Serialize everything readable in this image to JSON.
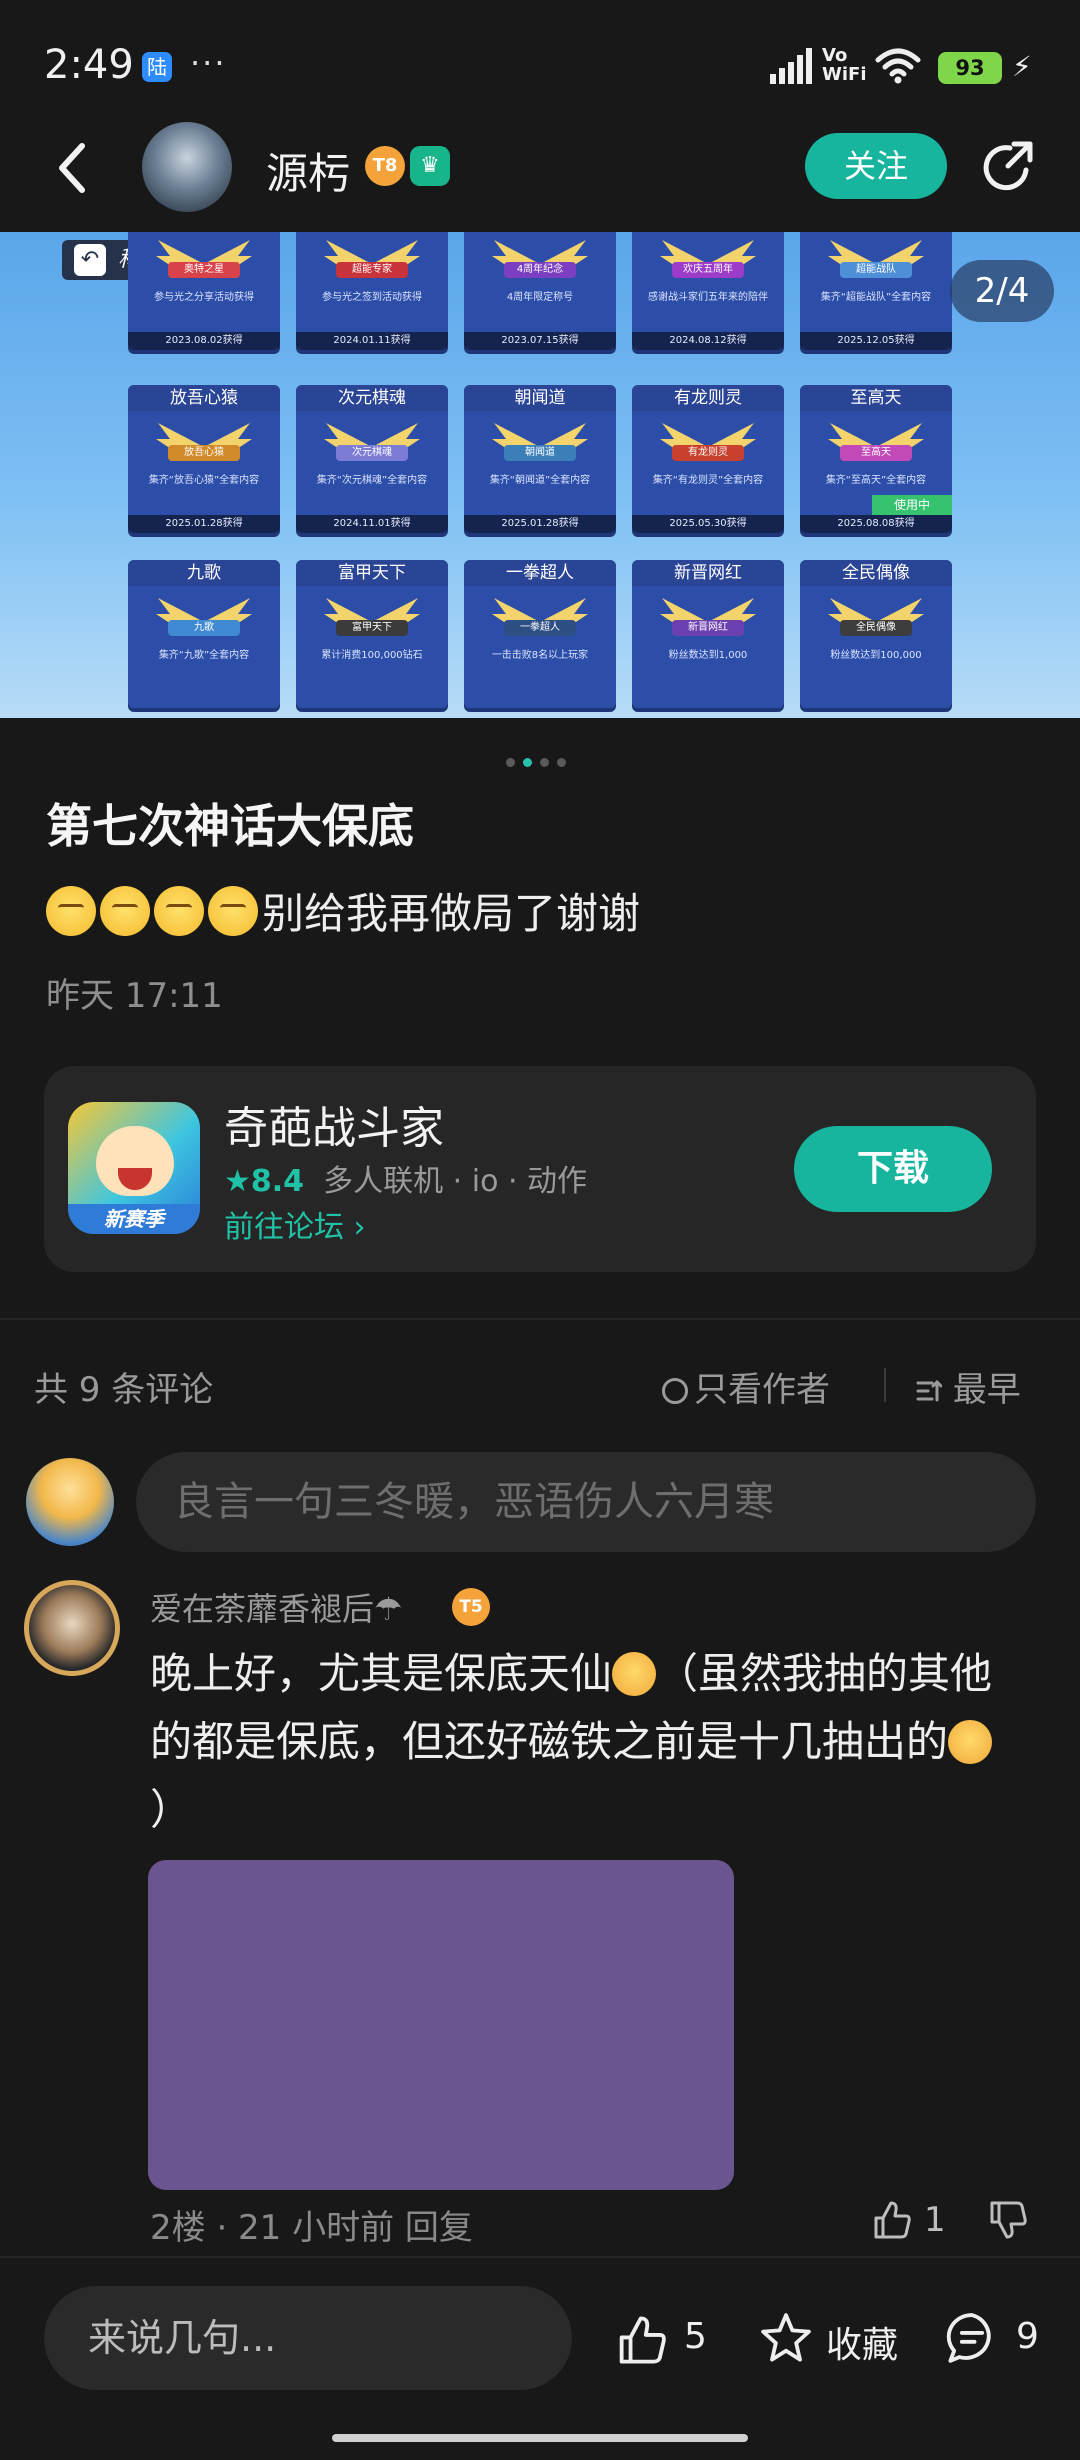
{
  "status_bar": {
    "time": "2:49",
    "app_badge": "陆",
    "more": "···",
    "vowifi": "Vo\nWiFi",
    "battery": "93"
  },
  "header": {
    "author": "源杇",
    "level": "8",
    "follow_label": "关注"
  },
  "banner": {
    "title_tag": "称号",
    "page_indicator": "2/4",
    "tiles": [
      {
        "cap": "奥特之星",
        "desc": "参与光之分享活动获得",
        "date": "2023.08.02获得",
        "color": "#d8434b"
      },
      {
        "cap": "超能专家",
        "desc": "参与光之签到活动获得",
        "date": "2024.01.11获得",
        "color": "#c9343c"
      },
      {
        "cap": "4周年纪念",
        "desc": "4周年限定称号",
        "date": "2023.07.15获得",
        "color": "#7d3fc2"
      },
      {
        "cap": "欢庆五周年",
        "desc": "感谢战斗家们五年来的陪伴",
        "date": "2024.08.12获得",
        "color": "#9c3cc8"
      },
      {
        "cap": "超能战队",
        "desc": "集齐“超能战队”全套内容",
        "date": "2025.12.05获得",
        "color": "#4e8fd8"
      },
      {
        "cap": "放吾心猿",
        "desc": "集齐“放吾心猿”全套内容",
        "date": "2025.01.28获得",
        "color": "#d18b2a"
      },
      {
        "cap": "次元棋魂",
        "desc": "集齐“次元棋魂”全套内容",
        "date": "2024.11.01获得",
        "color": "#7c7cd6"
      },
      {
        "cap": "朝闻道",
        "desc": "集齐“朝闻道”全套内容",
        "date": "2025.01.28获得",
        "color": "#3a7fb8"
      },
      {
        "cap": "有龙则灵",
        "desc": "集齐“有龙则灵”全套内容",
        "date": "2025.05.30获得",
        "color": "#c9402e"
      },
      {
        "cap": "至高天",
        "desc": "集齐“至高天”全套内容",
        "date": "2025.08.08获得",
        "color": "#c24ab8",
        "in_use": "使用中"
      },
      {
        "cap": "九歌",
        "desc": "集齐“九歌”全套内容",
        "date": "",
        "color": "#3f8ad2"
      },
      {
        "cap": "富甲天下",
        "desc": "累计消费100,000钻石",
        "date": "",
        "color": "#3b3b3b"
      },
      {
        "cap": "一拳超人",
        "desc": "一击击败8名以上玩家",
        "date": "",
        "color": "#2d4f84"
      },
      {
        "cap": "新晋网红",
        "desc": "粉丝数达到1,000",
        "date": "",
        "color": "#6c3fb0"
      },
      {
        "cap": "全民偶像",
        "desc": "粉丝数达到100,000",
        "date": "",
        "color": "#3d3d3d"
      }
    ]
  },
  "post": {
    "title": "第七次神话大保底",
    "body": "别给我再做局了谢谢",
    "time": "昨天 17:11"
  },
  "game_card": {
    "name": "奇葩战斗家",
    "score": "8.4",
    "tags": "多人联机 · io · 动作",
    "forum_link": "前往论坛 ›",
    "icon_tag": "新赛季",
    "download_label": "下载"
  },
  "comments_header": {
    "count_label": "共 9 条评论",
    "author_only": "只看作者",
    "sort_label": "最早"
  },
  "comment_input_placeholder": "良言一句三冬暖，恶语伤人六月寒",
  "comment": {
    "user": "爱在荼蘼香褪后",
    "level": "5",
    "text_a": "晚上好，尤其是保底天仙",
    "text_b": "（虽然我抽的其他的都是保底，但还好磁铁之前是十几抽出的",
    "text_c": "）",
    "meta": "2楼 · 21 小时前  回复",
    "likes": "1"
  },
  "bottom_bar": {
    "input_placeholder": "来说几句...",
    "likes": "5",
    "favorite_label": "收藏",
    "comments": "9"
  },
  "colors": {
    "accent": "#17b59e",
    "background": "#181818",
    "card": "#262626"
  }
}
